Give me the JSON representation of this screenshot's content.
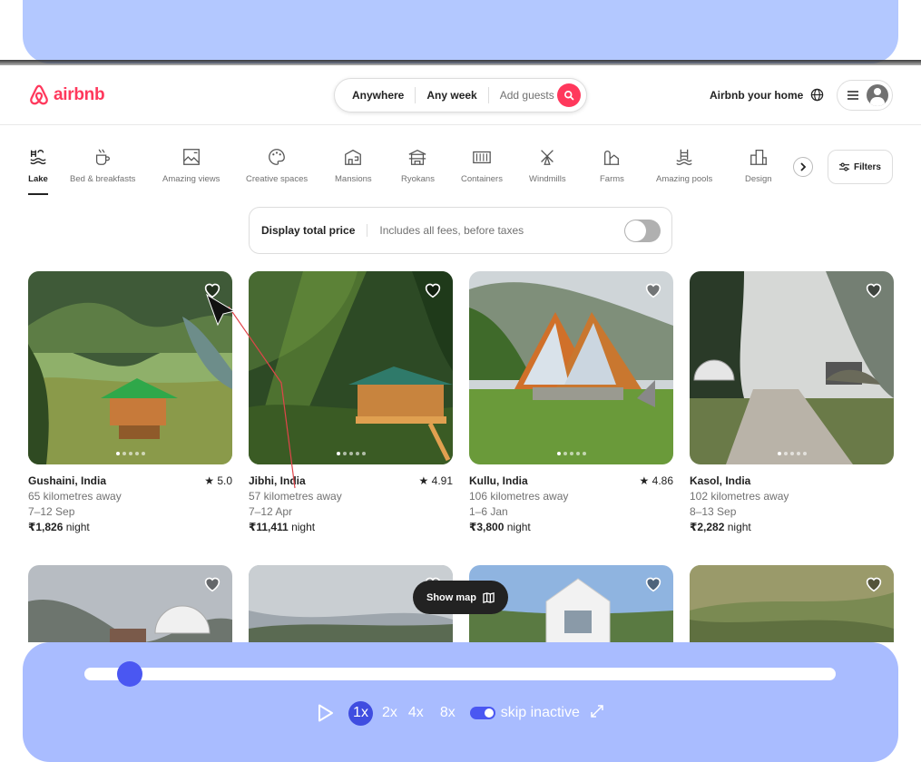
{
  "header": {
    "logo_text": "airbnb",
    "search_location": "Anywhere",
    "search_dates": "Any week",
    "search_guests": "Add guests",
    "host_link": "Airbnb your home"
  },
  "categories": [
    {
      "label": "Lake",
      "icon": "lake-icon",
      "active": true
    },
    {
      "label": "Bed & breakfasts",
      "icon": "coffee-icon"
    },
    {
      "label": "Amazing views",
      "icon": "views-icon"
    },
    {
      "label": "Creative spaces",
      "icon": "palette-icon"
    },
    {
      "label": "Mansions",
      "icon": "mansion-icon"
    },
    {
      "label": "Ryokans",
      "icon": "ryokan-icon"
    },
    {
      "label": "Containers",
      "icon": "container-icon"
    },
    {
      "label": "Windmills",
      "icon": "windmill-icon"
    },
    {
      "label": "Farms",
      "icon": "farm-icon"
    },
    {
      "label": "Amazing pools",
      "icon": "pool-icon"
    },
    {
      "label": "Design",
      "icon": "design-icon"
    }
  ],
  "filters_label": "Filters",
  "price_toggle": {
    "title": "Display total price",
    "subtitle": "Includes all fees, before taxes",
    "enabled": false
  },
  "listings": [
    {
      "location": "Gushaini, India",
      "rating": "5.0",
      "distance": "65 kilometres away",
      "dates": "7–12 Sep",
      "price": "₹1,826",
      "price_unit": "night"
    },
    {
      "location": "Jibhi, India",
      "rating": "4.91",
      "distance": "57 kilometres away",
      "dates": "7–12 Apr",
      "price": "₹11,411",
      "price_unit": "night"
    },
    {
      "location": "Kullu, India",
      "rating": "4.86",
      "distance": "106 kilometres away",
      "dates": "1–6 Jan",
      "price": "₹3,800",
      "price_unit": "night"
    },
    {
      "location": "Kasol, India",
      "rating": "",
      "distance": "102 kilometres away",
      "dates": "8–13 Sep",
      "price": "₹2,282",
      "price_unit": "night"
    }
  ],
  "show_map_label": "Show map",
  "player": {
    "progress": 0.06,
    "speeds": [
      "1x",
      "2x",
      "4x",
      "8x"
    ],
    "active_speed": "1x",
    "skip_label": "skip inactive",
    "skip_enabled": true
  },
  "colors": {
    "brand": "#ff385c",
    "player_accent": "#4a57f2",
    "player_bg": "#a9bcff"
  }
}
